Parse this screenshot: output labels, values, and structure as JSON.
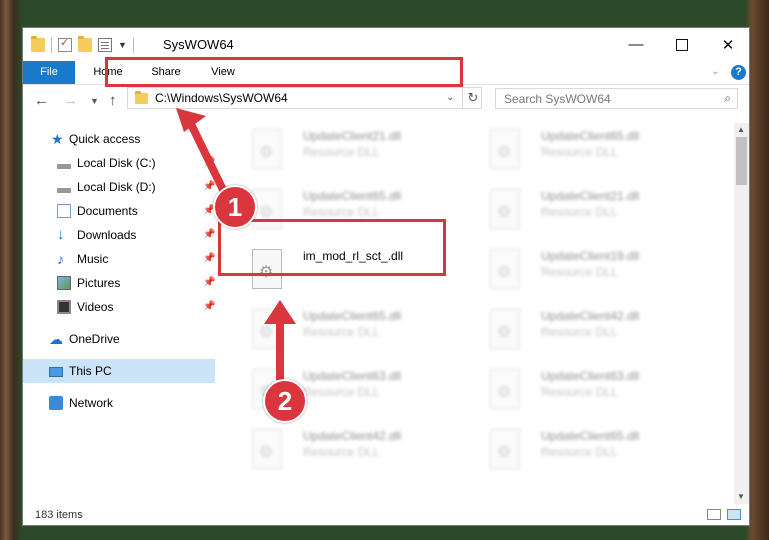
{
  "window": {
    "title": "SysWOW64",
    "minimize_glyph": "—",
    "close_glyph": "✕"
  },
  "ribbon": {
    "tabs": [
      "File",
      "Home",
      "Share",
      "View"
    ],
    "help_glyph": "?"
  },
  "navbar": {
    "address": "C:\\Windows\\SysWOW64",
    "search_placeholder": "Search SysWOW64"
  },
  "nav_pane": {
    "items": [
      {
        "label": "Quick access",
        "icon": "star-icon"
      },
      {
        "label": "Local Disk (C:)",
        "icon": "drive-icon",
        "pinned": true
      },
      {
        "label": "Local Disk (D:)",
        "icon": "drive-icon",
        "pinned": true
      },
      {
        "label": "Documents",
        "icon": "documents-icon",
        "pinned": true
      },
      {
        "label": "Downloads",
        "icon": "downloads-icon",
        "pinned": true
      },
      {
        "label": "Music",
        "icon": "music-icon",
        "pinned": true
      },
      {
        "label": "Pictures",
        "icon": "pictures-icon",
        "pinned": true
      },
      {
        "label": "Videos",
        "icon": "videos-icon",
        "pinned": true
      },
      {
        "label": "OneDrive",
        "icon": "cloud-icon"
      },
      {
        "label": "This PC",
        "icon": "computer-icon",
        "selected": true
      },
      {
        "label": "Network",
        "icon": "network-icon"
      }
    ]
  },
  "files": {
    "left_column": [
      {
        "name": "UpdateClient21.dll",
        "type": "Resource DLL"
      },
      {
        "name": "UpdateClient65.dll",
        "type": "Resource DLL"
      },
      {
        "name": "im_mod_rl_sct_.dll",
        "type": ""
      },
      {
        "name": "UpdateClient65.dll",
        "type": "Resource DLL"
      },
      {
        "name": "UpdateClient63.dll",
        "type": "Resource DLL"
      },
      {
        "name": "UpdateClient42.dll",
        "type": "Resource DLL"
      }
    ],
    "right_column": [
      {
        "name": "UpdateClient65.dll",
        "type": "Resource DLL"
      },
      {
        "name": "UpdateClient21.dll",
        "type": "Resource DLL"
      },
      {
        "name": "UpdateClient19.dll",
        "type": "Resource DLL"
      },
      {
        "name": "UpdateClient42.dll",
        "type": "Resource DLL"
      },
      {
        "name": "UpdateClient63.dll",
        "type": "Resource DLL"
      },
      {
        "name": "UpdateClient65.dll",
        "type": "Resource DLL"
      }
    ]
  },
  "status": {
    "item_count": "183 items"
  },
  "annotations": {
    "step1": "1",
    "step2": "2",
    "color": "#d9363e"
  }
}
